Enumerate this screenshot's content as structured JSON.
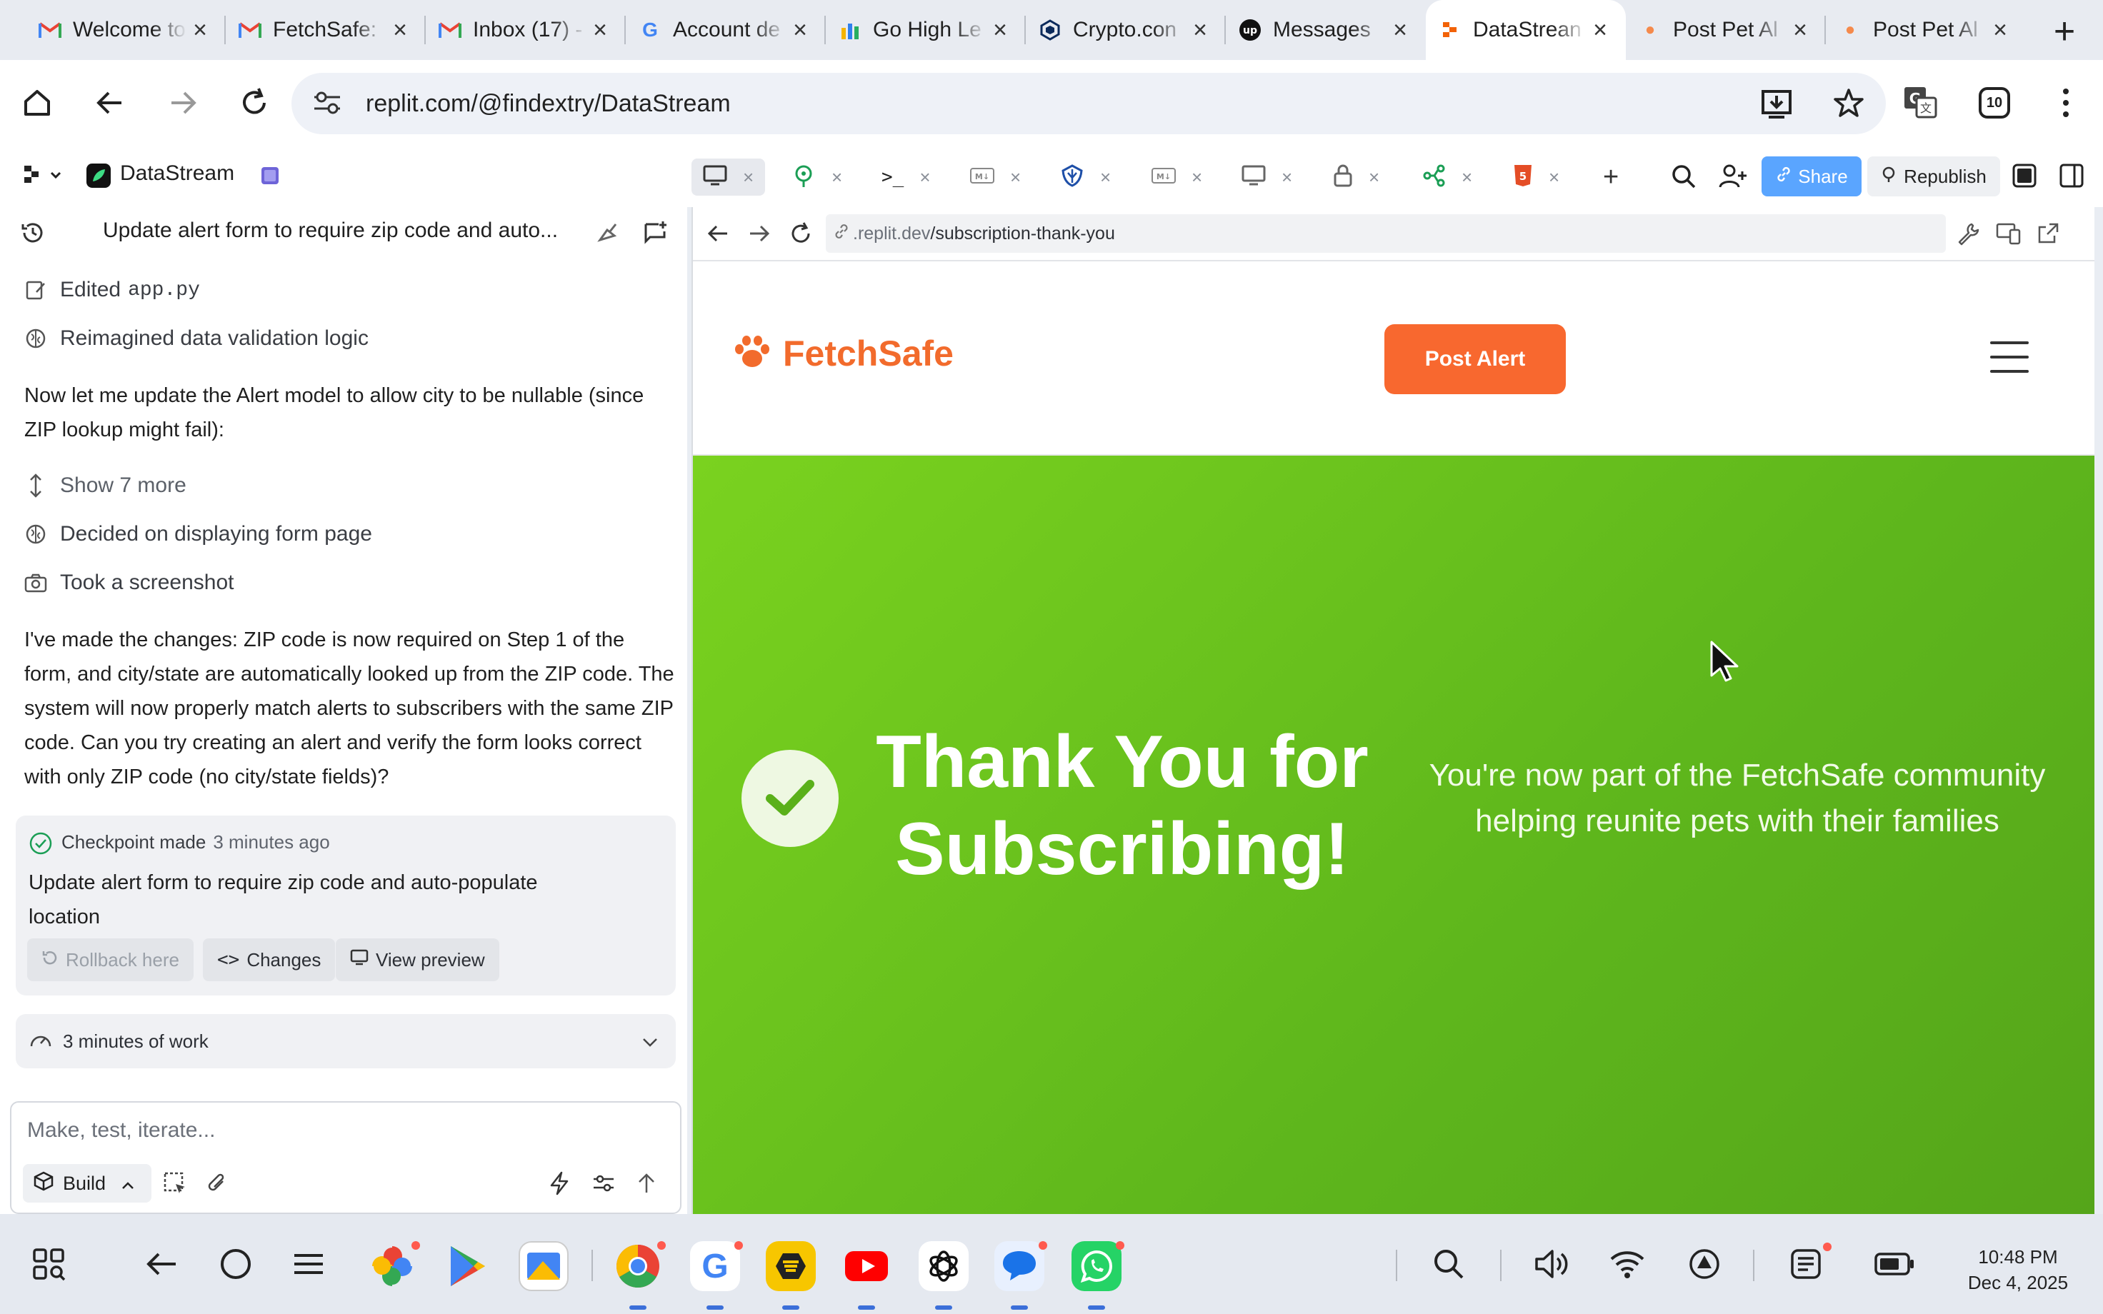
{
  "browser": {
    "tabs": [
      {
        "title": "Welcome to",
        "favicon": "gmail-icon",
        "active": false
      },
      {
        "title": "FetchSafe:",
        "favicon": "gmail-icon",
        "active": false
      },
      {
        "title": "Inbox (17) -",
        "favicon": "gmail-icon",
        "active": false
      },
      {
        "title": "Account de",
        "favicon": "google-icon",
        "active": false
      },
      {
        "title": "Go High Le",
        "favicon": "gohighlevel-icon",
        "active": false
      },
      {
        "title": "Crypto.con",
        "favicon": "crypto-icon",
        "active": false
      },
      {
        "title": "Messages",
        "favicon": "upwork-icon",
        "active": false
      },
      {
        "title": "DataStrean",
        "favicon": "replit-icon",
        "active": true
      },
      {
        "title": "Post Pet Al",
        "favicon": "paw-icon",
        "active": false
      },
      {
        "title": "Post Pet Al",
        "favicon": "paw-icon",
        "active": false
      }
    ],
    "url": "replit.com/@findextry/DataStream",
    "extension_badge": "10"
  },
  "replit": {
    "project_name": "DataStream",
    "share_label": "Share",
    "republish_label": "Republish"
  },
  "chat": {
    "title": "Update alert form to require zip code and auto...",
    "actions": {
      "edited_prefix": "Edited",
      "edited_file": "app.py",
      "reimagined": "Reimagined data validation logic",
      "show_more": "Show 7 more",
      "decided": "Decided on displaying form page",
      "screenshot": "Took a screenshot"
    },
    "message1": "Now let me update the Alert model to allow city to be nullable (since ZIP lookup might fail):",
    "message2": "I've made the changes: ZIP code is now required on Step 1 of the form, and city/state are automatically looked up from the ZIP code. The system will now properly match alerts to subscribers with the same ZIP code. Can you try creating an alert and verify the form looks correct with only ZIP code (no city/state fields)?",
    "checkpoint": {
      "label": "Checkpoint made",
      "time": "3 minutes ago",
      "message": "Update alert form to require zip code and auto-populate location",
      "rollback": "Rollback here",
      "changes": "Changes",
      "view_preview": "View preview"
    },
    "work_summary": "3 minutes of work",
    "input_placeholder": "Make, test, iterate...",
    "build_label": "Build"
  },
  "preview": {
    "url_host": ".replit.dev",
    "url_path": "/subscription-thank-you",
    "site": {
      "logo_text": "FetchSafe",
      "post_alert": "Post Alert",
      "hero_title": "Thank You for Subscribing!",
      "hero_subtitle": "You're now part of the FetchSafe community helping reunite pets with their families"
    }
  },
  "system": {
    "time": "10:48 PM",
    "date": "Dec 4, 2025"
  },
  "colors": {
    "accent_orange": "#f8682f",
    "hero_green": "#6cc41e",
    "share_blue": "#5aa5ff"
  }
}
